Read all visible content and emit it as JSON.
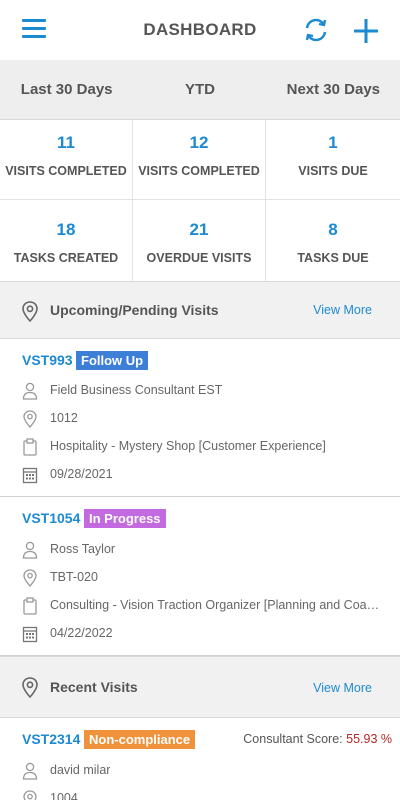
{
  "header": {
    "title": "DASHBOARD"
  },
  "periods": [
    "Last 30 Days",
    "YTD",
    "Next 30 Days"
  ],
  "stats": [
    {
      "value": "11",
      "label": "VISITS COMPLETED"
    },
    {
      "value": "12",
      "label": "VISITS COMPLETED"
    },
    {
      "value": "1",
      "label": "VISITS DUE"
    },
    {
      "value": "18",
      "label": "TASKS CREATED"
    },
    {
      "value": "21",
      "label": "OVERDUE VISITS"
    },
    {
      "value": "8",
      "label": "TASKS DUE"
    }
  ],
  "upcoming": {
    "title": "Upcoming/Pending Visits",
    "view_more": "View More",
    "visits": [
      {
        "id": "VST993",
        "status": "Follow Up",
        "status_color": "#3d7fd6",
        "consultant": "Field Business Consultant EST",
        "location": "1012",
        "category": "Hospitality - Mystery Shop [Customer Experience]",
        "date": "09/28/2021"
      },
      {
        "id": "VST1054",
        "status": "In Progress",
        "status_color": "#c36ae0",
        "consultant": "Ross Taylor",
        "location": "TBT-020",
        "category": "Consulting - Vision Traction Organizer [Planning and Coaching]",
        "date": "04/22/2022"
      }
    ]
  },
  "recent": {
    "title": "Recent Visits",
    "view_more": "View More",
    "visits": [
      {
        "id": "VST2314",
        "status": "Non-compliance",
        "status_color": "#f0913c",
        "score_label": "Consultant Score:",
        "score_value": "55.93 %",
        "consultant": "david milar",
        "location": "1004"
      }
    ]
  }
}
